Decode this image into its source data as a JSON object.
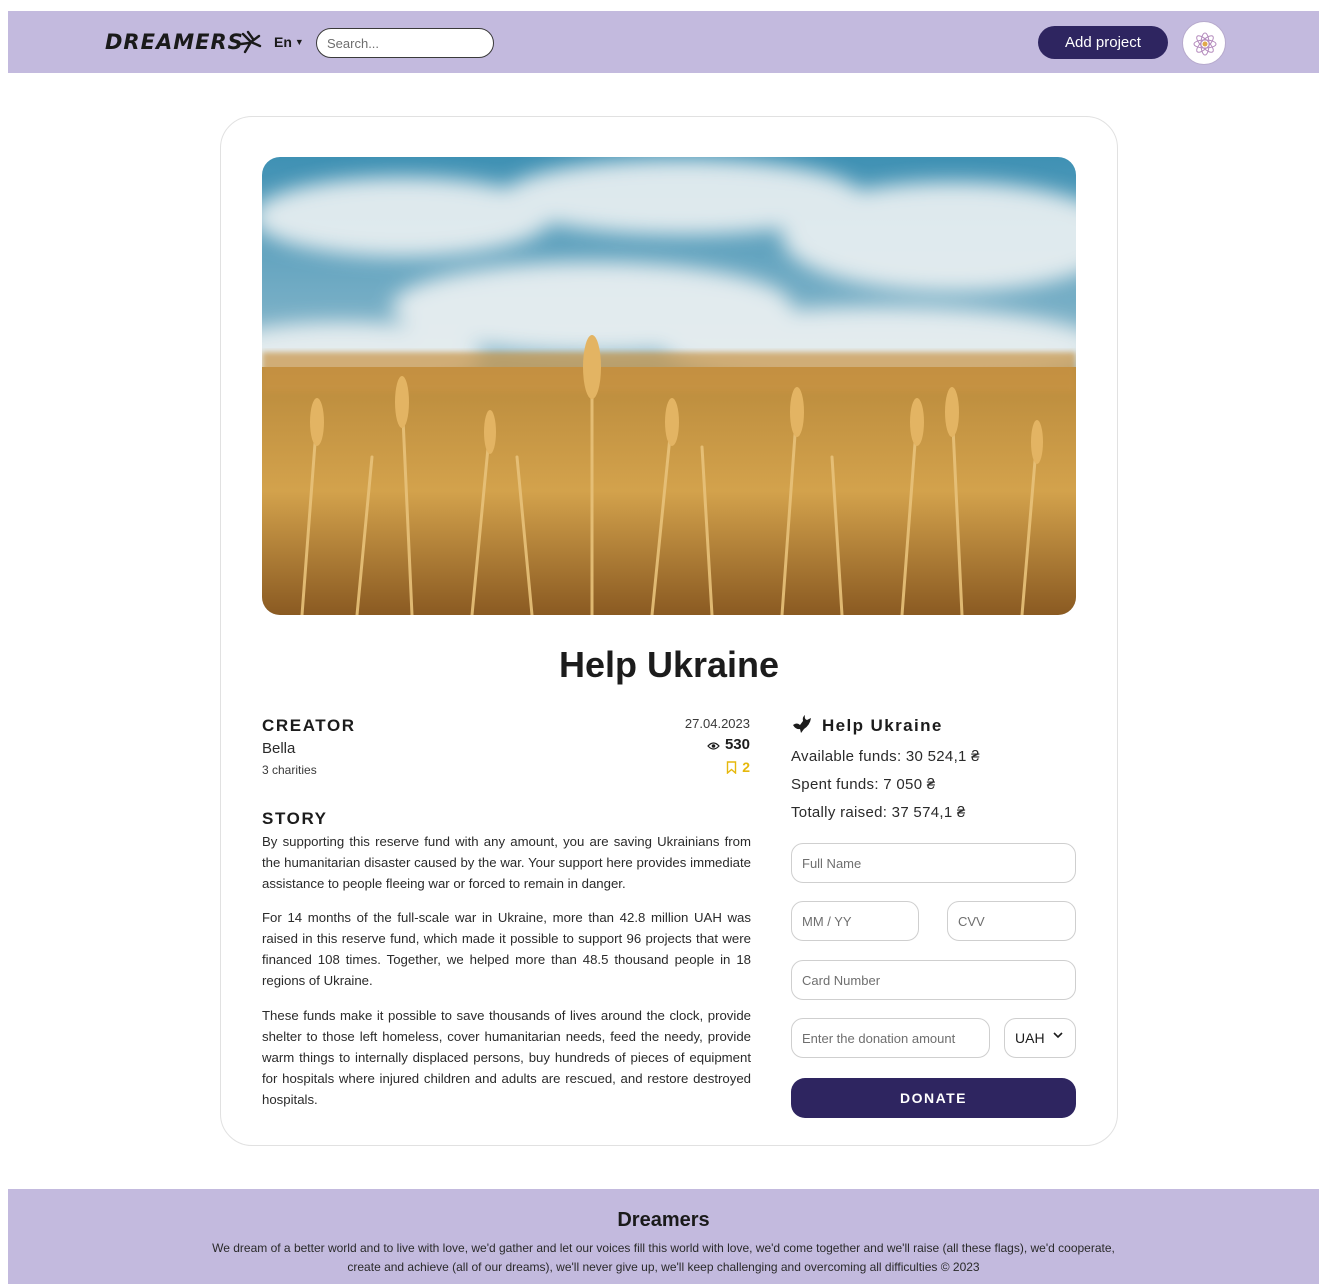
{
  "header": {
    "logo": "DREAMERS",
    "language": "En",
    "search_placeholder": "Search...",
    "add_project_label": "Add project"
  },
  "project": {
    "title": "Help Ukraine",
    "creator_heading": "CREATOR",
    "creator_name": "Bella",
    "creator_charities": "3 charities",
    "date": "27.04.2023",
    "views": "530",
    "saves": "2",
    "story_heading": "STORY",
    "story": [
      "By supporting this reserve fund with any amount, you are saving Ukrainians from the humanitarian disaster caused by the war. Your support here provides immediate assistance to people fleeing war or forced to remain in danger.",
      "For 14 months of the full-scale war in Ukraine, more than 42.8 million UAH was raised in this reserve fund, which made it possible to support 96 projects that were financed 108 times. Together, we helped more than 48.5 thousand people in 18 regions of Ukraine.",
      "These funds make it possible to save thousands of lives around the clock, provide shelter to those left homeless, cover humanitarian needs, feed the needy, provide warm things to internally displaced persons, buy hundreds of pieces of equipment for hospitals where injured children and adults are rescued, and restore destroyed hospitals."
    ]
  },
  "donation": {
    "title": "Help Ukraine",
    "available": "Available funds: 30 524,1 ₴",
    "spent": "Spent funds: 7 050 ₴",
    "raised": "Totally raised: 37 574,1 ₴",
    "full_name_placeholder": "Full Name",
    "expiry_placeholder": "MM / YY",
    "cvv_placeholder": "CVV",
    "card_placeholder": "Card Number",
    "amount_placeholder": "Enter the donation amount",
    "currency": "UAH",
    "donate_label": "DONATE"
  },
  "footer": {
    "title": "Dreamers",
    "line1": "We dream of a better world and to live with love, we'd gather and let our voices fill this world with love, we'd come together and we'll raise (all these flags), we'd cooperate,",
    "line2": "create and achieve (all of our dreams), we'll never give up, we'll keep challenging and overcoming all difficulties © 2023"
  },
  "colors": {
    "header_bg": "#c3bade",
    "primary": "#2e2560",
    "bookmark": "#e6b80c"
  }
}
